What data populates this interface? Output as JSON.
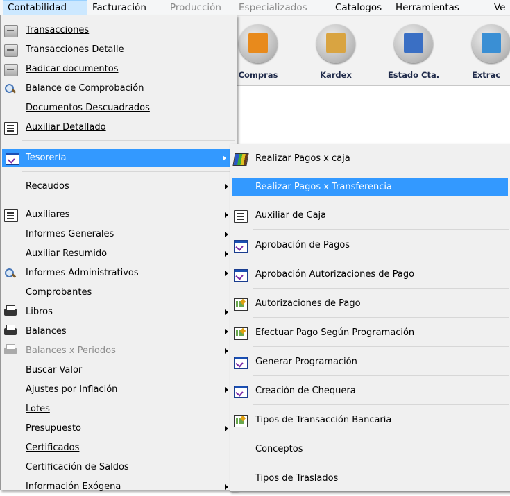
{
  "menubar": {
    "items": [
      {
        "label": "Contabilidad",
        "active": true,
        "disabled": false
      },
      {
        "label": "Facturación",
        "active": false,
        "disabled": false
      },
      {
        "label": "Producción",
        "active": false,
        "disabled": true
      },
      {
        "label": "Especializados",
        "active": false,
        "disabled": true
      },
      {
        "label": "Catalogos",
        "active": false,
        "disabled": false
      },
      {
        "label": "Herramientas",
        "active": false,
        "disabled": false
      },
      {
        "label": "Ve",
        "active": false,
        "disabled": false
      }
    ]
  },
  "toolbar": {
    "buttons": [
      {
        "label": "Compras",
        "icon": "truck-icon",
        "color": "#e88a1c"
      },
      {
        "label": "Kardex",
        "icon": "clipboard-add-icon",
        "color": "#d9a441"
      },
      {
        "label": "Estado Cta.",
        "icon": "id-card-icon",
        "color": "#3a6fc4"
      },
      {
        "label": "Extrac",
        "icon": "document-arrow-icon",
        "color": "#3a8fd4"
      }
    ]
  },
  "main_menu": {
    "items": [
      {
        "label": "Transacciones",
        "icon": "scroll-icon",
        "underline": true
      },
      {
        "label": "Transacciones Detalle",
        "icon": "scroll-icon",
        "underline": true
      },
      {
        "label": "Radicar documentos",
        "icon": "scroll-icon",
        "underline": true
      },
      {
        "label": "Balance de Comprobación",
        "icon": "magnifier-icon",
        "underline": true
      },
      {
        "label": "Documentos Descuadrados",
        "icon": "",
        "underline": true
      },
      {
        "label": "Auxiliar Detallado",
        "icon": "document-list-icon",
        "underline": true
      },
      {
        "label": "Tesorería",
        "icon": "approval-window-icon",
        "submenu": true,
        "highlighted": true
      },
      {
        "label": "Recaudos",
        "icon": "",
        "submenu": true
      },
      {
        "label": "Auxiliares",
        "icon": "document-list-icon",
        "submenu": true
      },
      {
        "label": "Informes Generales",
        "icon": "",
        "submenu": true
      },
      {
        "label": "Auxiliar Resumido",
        "icon": "",
        "submenu": true,
        "underline": true
      },
      {
        "label": "Informes Administrativos",
        "icon": "magnifier-icon",
        "submenu": true
      },
      {
        "label": "Comprobantes",
        "icon": ""
      },
      {
        "label": "Libros",
        "icon": "printer-icon",
        "submenu": true
      },
      {
        "label": "Balances",
        "icon": "printer-icon",
        "submenu": true
      },
      {
        "label": "Balances x Periodos",
        "icon": "printer-icon",
        "submenu": true,
        "disabled": true
      },
      {
        "label": "Buscar Valor",
        "icon": ""
      },
      {
        "label": "Ajustes por Inflación",
        "icon": "",
        "submenu": true,
        "underline": true
      },
      {
        "label": "Lotes",
        "icon": "",
        "underline": true
      },
      {
        "label": "Presupuesto",
        "icon": "",
        "submenu": true
      },
      {
        "label": "Certificados",
        "icon": "",
        "underline": true
      },
      {
        "label": "Certificación de Saldos",
        "icon": ""
      },
      {
        "label": "Información Exógena",
        "icon": "",
        "submenu": true
      }
    ]
  },
  "tesoreria_menu": {
    "items": [
      {
        "label": "Realizar Pagos x caja",
        "icon": "books-icon"
      },
      {
        "label": "Realizar Pagos x Transferencia",
        "icon": "",
        "highlighted": true
      },
      {
        "label": "Auxiliar de Caja",
        "icon": "document-list-icon"
      },
      {
        "label": "Aprobación de Pagos",
        "icon": "approval-window-icon"
      },
      {
        "label": "Aprobación Autorizaciones de Pago",
        "icon": "approval-window-icon"
      },
      {
        "label": "Autorizaciones de Pago",
        "icon": "grid-edit-icon"
      },
      {
        "label": "Efectuar Pago Según Programación",
        "icon": "grid-edit-icon"
      },
      {
        "label": "Generar Programación",
        "icon": "approval-window-icon"
      },
      {
        "label": "Creación de Chequera",
        "icon": "approval-window-icon"
      },
      {
        "label": "Tipos de Transacción Bancaria",
        "icon": "grid-edit-icon"
      },
      {
        "label": "Conceptos",
        "icon": ""
      },
      {
        "label": "Tipos de Traslados",
        "icon": ""
      }
    ]
  }
}
